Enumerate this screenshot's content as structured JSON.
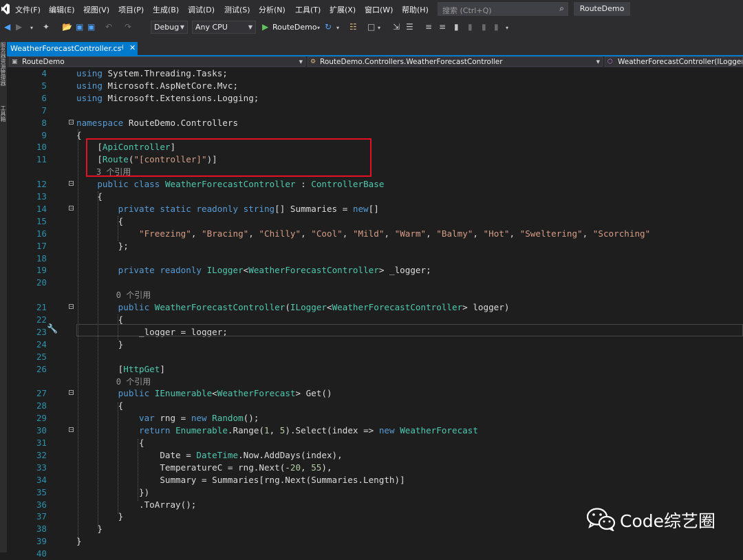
{
  "menu": {
    "items": [
      "文件(F)",
      "编辑(E)",
      "视图(V)",
      "项目(P)",
      "生成(B)",
      "调试(D)",
      "测试(S)",
      "分析(N)",
      "工具(T)",
      "扩展(X)",
      "窗口(W)",
      "帮助(H)"
    ],
    "search_placeholder": "搜索 (Ctrl+Q)",
    "solution_name": "RouteDemo"
  },
  "toolbar": {
    "config": "Debug",
    "platform": "Any CPU",
    "run_target": "RouteDemo"
  },
  "left_strip": [
    "服务器资源管理器",
    "工具箱"
  ],
  "tab": {
    "file_name": "WeatherForecastController.cs",
    "pin_glyph": "⊣",
    "close_glyph": "✕"
  },
  "nav": {
    "project": "RouteDemo",
    "class": "RouteDemo.Controllers.WeatherForecastController",
    "member": "WeatherForecastController(ILogger<"
  },
  "code_lines": [
    {
      "n": "4",
      "fold": false,
      "code": [
        [
          "kw",
          "using"
        ],
        [
          "p",
          " System.Threading.Tasks;"
        ]
      ]
    },
    {
      "n": "5",
      "fold": false,
      "code": [
        [
          "kw",
          "using"
        ],
        [
          "p",
          " Microsoft.AspNetCore.Mvc;"
        ]
      ]
    },
    {
      "n": "6",
      "fold": false,
      "code": [
        [
          "kw",
          "using"
        ],
        [
          "p",
          " Microsoft.Extensions.Logging;"
        ]
      ]
    },
    {
      "n": "7",
      "fold": false,
      "code": []
    },
    {
      "n": "8",
      "fold": true,
      "code": [
        [
          "kw",
          "namespace"
        ],
        [
          "p",
          " RouteDemo.Controllers"
        ]
      ]
    },
    {
      "n": "9",
      "fold": false,
      "code": [
        [
          "p",
          "{"
        ]
      ]
    },
    {
      "n": "10",
      "fold": false,
      "code": [
        [
          "p",
          "    ["
        ],
        [
          "ty",
          "ApiController"
        ],
        [
          "p",
          "]"
        ]
      ]
    },
    {
      "n": "11",
      "fold": false,
      "code": [
        [
          "p",
          "    ["
        ],
        [
          "ty",
          "Route"
        ],
        [
          "p",
          "("
        ],
        [
          "st",
          "\"[controller]\""
        ],
        [
          "p",
          ")]"
        ]
      ]
    },
    {
      "n": "",
      "fold": false,
      "code": [
        [
          "cl",
          "    3 个引用"
        ]
      ]
    },
    {
      "n": "12",
      "fold": true,
      "code": [
        [
          "p",
          "    "
        ],
        [
          "kw",
          "public class"
        ],
        [
          "p",
          " "
        ],
        [
          "ty",
          "WeatherForecastController"
        ],
        [
          "p",
          " : "
        ],
        [
          "ty",
          "ControllerBase"
        ]
      ]
    },
    {
      "n": "13",
      "fold": false,
      "code": [
        [
          "p",
          "    {"
        ]
      ]
    },
    {
      "n": "14",
      "fold": true,
      "code": [
        [
          "p",
          "        "
        ],
        [
          "kw",
          "private static readonly string"
        ],
        [
          "p",
          "[] Summaries = "
        ],
        [
          "kw",
          "new"
        ],
        [
          "p",
          "[]"
        ]
      ]
    },
    {
      "n": "15",
      "fold": false,
      "code": [
        [
          "p",
          "        {"
        ]
      ]
    },
    {
      "n": "16",
      "fold": false,
      "code": [
        [
          "p",
          "            "
        ],
        [
          "st",
          "\"Freezing\""
        ],
        [
          "p",
          ", "
        ],
        [
          "st",
          "\"Bracing\""
        ],
        [
          "p",
          ", "
        ],
        [
          "st",
          "\"Chilly\""
        ],
        [
          "p",
          ", "
        ],
        [
          "st",
          "\"Cool\""
        ],
        [
          "p",
          ", "
        ],
        [
          "st",
          "\"Mild\""
        ],
        [
          "p",
          ", "
        ],
        [
          "st",
          "\"Warm\""
        ],
        [
          "p",
          ", "
        ],
        [
          "st",
          "\"Balmy\""
        ],
        [
          "p",
          ", "
        ],
        [
          "st",
          "\"Hot\""
        ],
        [
          "p",
          ", "
        ],
        [
          "st",
          "\"Sweltering\""
        ],
        [
          "p",
          ", "
        ],
        [
          "st",
          "\"Scorching\""
        ]
      ]
    },
    {
      "n": "17",
      "fold": false,
      "code": [
        [
          "p",
          "        };"
        ]
      ]
    },
    {
      "n": "18",
      "fold": false,
      "code": []
    },
    {
      "n": "19",
      "fold": false,
      "code": [
        [
          "p",
          "        "
        ],
        [
          "kw",
          "private readonly"
        ],
        [
          "p",
          " "
        ],
        [
          "ty",
          "ILogger"
        ],
        [
          "p",
          "<"
        ],
        [
          "ty",
          "WeatherForecastController"
        ],
        [
          "p",
          "> _logger;"
        ]
      ]
    },
    {
      "n": "20",
      "fold": false,
      "code": []
    },
    {
      "n": "",
      "fold": false,
      "code": [
        [
          "cl",
          "        0 个引用"
        ]
      ]
    },
    {
      "n": "21",
      "fold": true,
      "code": [
        [
          "p",
          "        "
        ],
        [
          "kw",
          "public"
        ],
        [
          "p",
          " "
        ],
        [
          "ty",
          "WeatherForecastController"
        ],
        [
          "p",
          "("
        ],
        [
          "ty",
          "ILogger"
        ],
        [
          "p",
          "<"
        ],
        [
          "ty",
          "WeatherForecastController"
        ],
        [
          "p",
          "> logger)"
        ]
      ]
    },
    {
      "n": "22",
      "fold": false,
      "code": [
        [
          "p",
          "        {"
        ]
      ]
    },
    {
      "n": "23",
      "fold": false,
      "code": [
        [
          "p",
          "            _logger = logger;"
        ]
      ]
    },
    {
      "n": "24",
      "fold": false,
      "code": [
        [
          "p",
          "        }"
        ]
      ]
    },
    {
      "n": "25",
      "fold": false,
      "code": []
    },
    {
      "n": "26",
      "fold": false,
      "code": [
        [
          "p",
          "        ["
        ],
        [
          "ty",
          "HttpGet"
        ],
        [
          "p",
          "]"
        ]
      ]
    },
    {
      "n": "",
      "fold": false,
      "code": [
        [
          "cl",
          "        0 个引用"
        ]
      ]
    },
    {
      "n": "27",
      "fold": true,
      "code": [
        [
          "p",
          "        "
        ],
        [
          "kw",
          "public"
        ],
        [
          "p",
          " "
        ],
        [
          "ty",
          "IEnumerable"
        ],
        [
          "p",
          "<"
        ],
        [
          "ty",
          "WeatherForecast"
        ],
        [
          "p",
          "> Get()"
        ]
      ]
    },
    {
      "n": "28",
      "fold": false,
      "code": [
        [
          "p",
          "        {"
        ]
      ]
    },
    {
      "n": "29",
      "fold": false,
      "code": [
        [
          "p",
          "            "
        ],
        [
          "kw",
          "var"
        ],
        [
          "p",
          " rng = "
        ],
        [
          "kw",
          "new"
        ],
        [
          "p",
          " "
        ],
        [
          "ty",
          "Random"
        ],
        [
          "p",
          "();"
        ]
      ]
    },
    {
      "n": "30",
      "fold": true,
      "code": [
        [
          "p",
          "            "
        ],
        [
          "kw",
          "return"
        ],
        [
          "p",
          " "
        ],
        [
          "ty",
          "Enumerable"
        ],
        [
          "p",
          ".Range("
        ],
        [
          "nu",
          "1"
        ],
        [
          "p",
          ", "
        ],
        [
          "nu",
          "5"
        ],
        [
          "p",
          ").Select(index => "
        ],
        [
          "kw",
          "new"
        ],
        [
          "p",
          " "
        ],
        [
          "ty",
          "WeatherForecast"
        ]
      ]
    },
    {
      "n": "31",
      "fold": false,
      "code": [
        [
          "p",
          "            {"
        ]
      ]
    },
    {
      "n": "32",
      "fold": false,
      "code": [
        [
          "p",
          "                Date = "
        ],
        [
          "ty",
          "DateTime"
        ],
        [
          "p",
          ".Now.AddDays(index),"
        ]
      ]
    },
    {
      "n": "33",
      "fold": false,
      "code": [
        [
          "p",
          "                TemperatureC = rng.Next(-"
        ],
        [
          "nu",
          "20"
        ],
        [
          "p",
          ", "
        ],
        [
          "nu",
          "55"
        ],
        [
          "p",
          "),"
        ]
      ]
    },
    {
      "n": "34",
      "fold": false,
      "code": [
        [
          "p",
          "                Summary = Summaries[rng.Next(Summaries.Length)]"
        ]
      ]
    },
    {
      "n": "35",
      "fold": false,
      "code": [
        [
          "p",
          "            })"
        ]
      ]
    },
    {
      "n": "36",
      "fold": false,
      "code": [
        [
          "p",
          "            .ToArray();"
        ]
      ]
    },
    {
      "n": "37",
      "fold": false,
      "code": [
        [
          "p",
          "        }"
        ]
      ]
    },
    {
      "n": "38",
      "fold": false,
      "code": [
        [
          "p",
          "    }"
        ]
      ]
    },
    {
      "n": "39",
      "fold": false,
      "code": [
        [
          "p",
          "}"
        ]
      ]
    },
    {
      "n": "40",
      "fold": false,
      "code": []
    }
  ],
  "watermark": {
    "text": "Code综艺圈",
    "icon": "wechat-icon"
  },
  "colors": {
    "accent": "#007acc",
    "highlight_box": "#e81123",
    "keyword": "#569cd6",
    "type": "#4ec9b0",
    "string": "#d69d85",
    "line_number": "#2b91af"
  }
}
